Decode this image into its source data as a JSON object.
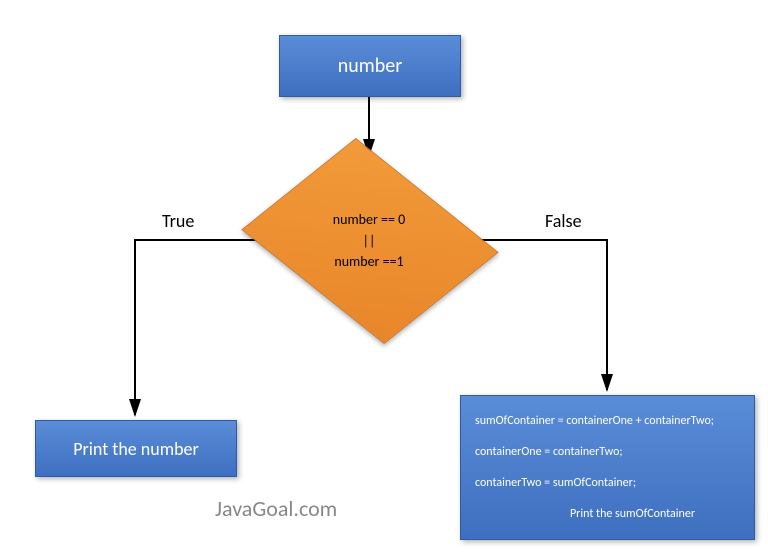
{
  "start": {
    "label": "number"
  },
  "decision": {
    "line1": "number == 0",
    "line2": "||",
    "line3": "number ==1"
  },
  "edges": {
    "true_label": "True",
    "false_label": "False"
  },
  "true_branch": {
    "text": "Print the number"
  },
  "false_branch": {
    "line1": "sumOfContainer = containerOne + containerTwo;",
    "line2": "containerOne = containerTwo;",
    "line3": "containerTwo = sumOfContainer;",
    "line4": "Print the sumOfContainer"
  },
  "watermark": "JavaGoal.com"
}
